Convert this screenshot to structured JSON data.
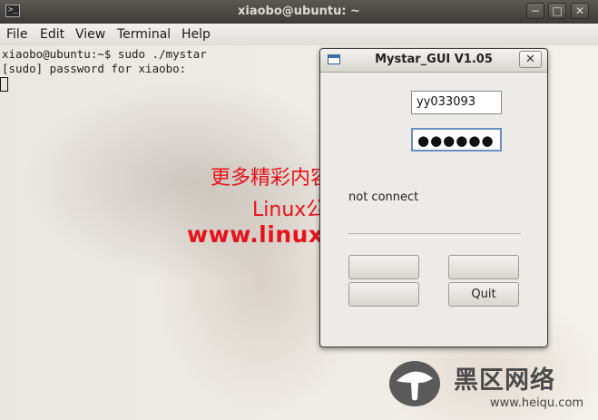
{
  "terminal": {
    "title": "xiaobo@ubuntu: ~",
    "menu": [
      "File",
      "Edit",
      "View",
      "Terminal",
      "Help"
    ],
    "lines": [
      "xiaobo@ubuntu:~$ sudo ./mystar",
      "[sudo] password for xiaobo:"
    ]
  },
  "watermark": {
    "line1": "更多精彩内容尽在",
    "line2": "Linux公社",
    "line3": "www.linuxidc.com"
  },
  "dialog": {
    "title": "Mystar_GUI V1.05",
    "close_label": "✕",
    "username": "yy033093",
    "password_mask": "●●●●●●",
    "status": "not connect",
    "button_a": "",
    "button_b": "",
    "button_c": "",
    "quit_label": "Quit"
  },
  "logo": {
    "name_cn": "黑区网络",
    "url": "www.heiqu.com"
  },
  "colors": {
    "watermark_red": "#e8121a",
    "titlebar_dark": "#3c3b37"
  }
}
